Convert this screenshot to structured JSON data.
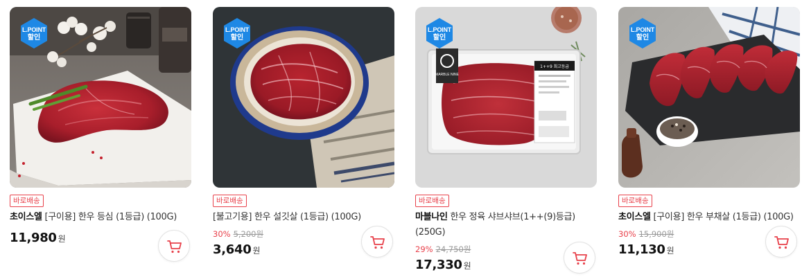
{
  "products": [
    {
      "badge": "L.POINT",
      "badge_sub": "할인",
      "delivery_tag": "바로배송",
      "brand": "초이스엘",
      "name": " [구이용] 한우 등심 (1등급) (100G)",
      "discount_pct": "",
      "original_price": "",
      "price": "11,980",
      "currency": "원",
      "image_icon": "beef-sirloin-on-board-image"
    },
    {
      "badge": "L.POINT",
      "badge_sub": "할인",
      "delivery_tag": "바로배송",
      "brand": "",
      "name": "[불고기용] 한우 설깃살 (1등급) (100G)",
      "discount_pct": "30%",
      "original_price": "5,200원",
      "price": "3,640",
      "currency": "원",
      "image_icon": "bulgogi-beef-plate-image"
    },
    {
      "badge": "L.POINT",
      "badge_sub": "할인",
      "delivery_tag": "바로배송",
      "brand": "마블나인",
      "name": " 한우 정육 샤브샤브(1++(9)등급) (250G)",
      "discount_pct": "29%",
      "original_price": "24,750원",
      "price": "17,330",
      "currency": "원",
      "image_icon": "packaged-shabu-beef-image",
      "package_brand": "MARBLE NINE",
      "package_label": "1++9 최고등급"
    },
    {
      "badge": "L.POINT",
      "badge_sub": "할인",
      "delivery_tag": "바로배송",
      "brand": "초이스엘",
      "name": " [구이용] 한우 부채살 (1등급) (100G)",
      "discount_pct": "30%",
      "original_price": "15,900원",
      "price": "11,130",
      "currency": "원",
      "image_icon": "beef-flat-iron-slate-image"
    }
  ],
  "colors": {
    "badge_blue": "#1e88e5",
    "sale_red": "#e8404a",
    "cart_red": "#e8404a"
  },
  "icons": {
    "cart": "shopping-cart-icon",
    "badge": "lpoint-hexagon-icon"
  }
}
